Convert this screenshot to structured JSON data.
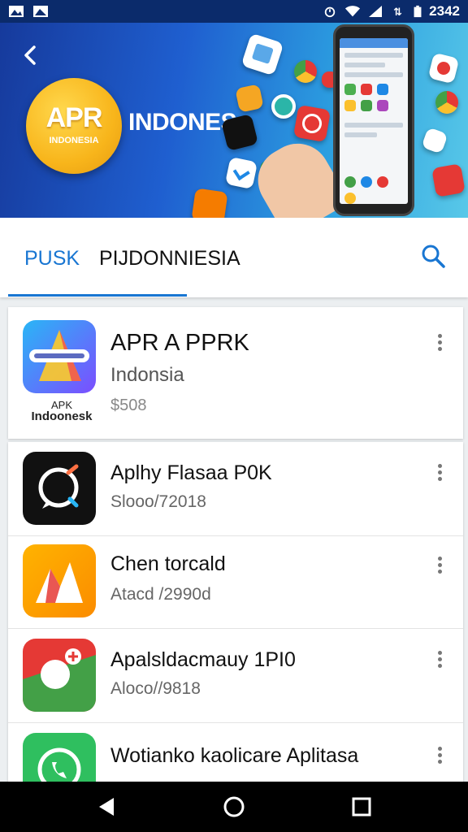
{
  "status_bar": {
    "time": "2342"
  },
  "header": {
    "logo_main": "APR",
    "logo_sub": "INDONESIA",
    "title": "INDONES"
  },
  "tabs": [
    {
      "label": "PUSK",
      "active": true
    },
    {
      "label": "PIJDONNIESIA",
      "active": false
    }
  ],
  "featured": {
    "title": "APR A PPRK",
    "subtitle": "Indonsia",
    "price": "$508",
    "caption_1": "APK",
    "caption_2": "Indoonesk"
  },
  "apps": [
    {
      "title": "Aplhy Flasaa P0K",
      "subtitle": "Slooo/72018"
    },
    {
      "title": "Chen torcald",
      "subtitle": "Atacd /2990d"
    },
    {
      "title": "Apalsldacmauy 1PI0",
      "subtitle": "Aloco//9818"
    },
    {
      "title": "Wotianko kaolicare Aplitasa",
      "subtitle": ""
    }
  ],
  "colors": {
    "accent": "#1976d2",
    "status_bar": "#0b2b6b"
  }
}
